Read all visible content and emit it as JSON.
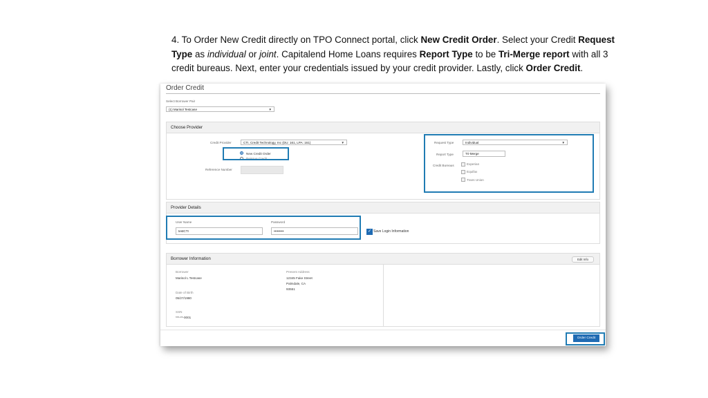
{
  "instruction": {
    "p1": "4. To Order New Credit directly on TPO Connect portal, click ",
    "b1": "New Credit Order",
    "p2": ". Select your Credit ",
    "b2": "Request Type",
    "p3": " as ",
    "i1": "individual",
    "p4": " or ",
    "i2": "joint",
    "p5": ". Capitalend Home Loans requires ",
    "b3": "Report Type",
    "p6": " to be ",
    "b4": "Tri-Merge report",
    "p7": " with all 3 credit bureaus. Next, enter your credentials issued by your credit provider. Lastly, click ",
    "b5": "Order Credit",
    "p8": "."
  },
  "page": {
    "title": "Order Credit",
    "borrower_pair_label": "Select Borrower Pair",
    "borrower_pair_value": "(1) Marisol Testcase"
  },
  "choose_provider": {
    "heading": "Choose Provider",
    "credit_provider_label": "Credit Provider",
    "credit_provider_value": "CTI, Credit Technology, Inc (DU: 161, LPA: 161)",
    "new_order_label": "New Credit Order",
    "reissue_label": "Reissue Credit",
    "reference_label": "Reference Number",
    "request_type_label": "Request Type",
    "request_type_value": "Individual",
    "report_type_label": "Report Type",
    "report_type_value": "Tri-Merge",
    "bureaus_label": "Credit Bureaus",
    "bureaus": [
      "Experian",
      "Equifax",
      "Trans Union"
    ]
  },
  "provider_details": {
    "heading": "Provider Details",
    "username_label": "User Name",
    "username_value": "testCTI",
    "password_label": "Password",
    "password_value": "•••••••••",
    "save_login_label": "Save Login Information"
  },
  "borrower_info": {
    "heading": "Borrower Information",
    "edit_label": "Edit Info",
    "borrower_label": "Borrower",
    "borrower_value": "Marisol L Testcase",
    "address_label": "Present Address",
    "address_line1": "12345 Fake Street",
    "address_line2": "Palmdale, CA",
    "address_line3": "93551",
    "dob_label": "Date of Birth",
    "dob_value": "05/27/1980",
    "ssn_label": "SSN",
    "ssn_value": "***-**-0001"
  },
  "actions": {
    "order_credit_label": "Order Credit"
  },
  "colors": {
    "highlight": "#1f7bb3",
    "primary_button": "#1f6bb3"
  }
}
